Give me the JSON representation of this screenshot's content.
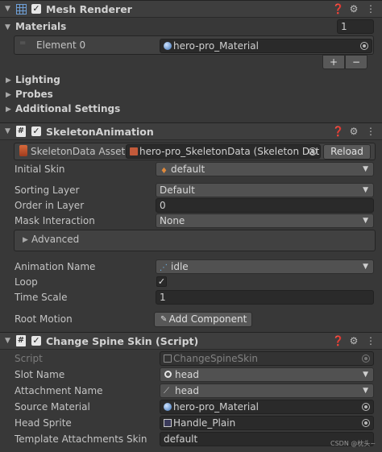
{
  "mesh_renderer": {
    "title": "Mesh Renderer",
    "materials_label": "Materials",
    "materials_count": "1",
    "element0_label": "Element 0",
    "element0_value": "hero-pro_Material",
    "plus": "+",
    "minus": "−",
    "lighting": "Lighting",
    "probes": "Probes",
    "additional_settings": "Additional Settings"
  },
  "skeleton_animation": {
    "title": "SkeletonAnimation",
    "skeleton_data_label": "SkeletonData Asset",
    "skeleton_data_value": "hero-pro_SkeletonData (Skeleton Dat",
    "reload": "Reload",
    "initial_skin_label": "Initial Skin",
    "initial_skin_value": "default",
    "sorting_layer_label": "Sorting Layer",
    "sorting_layer_value": "Default",
    "order_in_layer_label": "Order in Layer",
    "order_in_layer_value": "0",
    "mask_interaction_label": "Mask Interaction",
    "mask_interaction_value": "None",
    "advanced": "Advanced",
    "animation_name_label": "Animation Name",
    "animation_name_value": "idle",
    "loop_label": "Loop",
    "time_scale_label": "Time Scale",
    "time_scale_value": "1",
    "root_motion_label": "Root Motion",
    "add_component": "Add Component"
  },
  "change_spine_skin": {
    "title": "Change Spine Skin (Script)",
    "script_label": "Script",
    "script_value": "ChangeSpineSkin",
    "slot_name_label": "Slot Name",
    "slot_name_value": "head",
    "attachment_name_label": "Attachment Name",
    "attachment_name_value": "head",
    "source_material_label": "Source Material",
    "source_material_value": "hero-pro_Material",
    "head_sprite_label": "Head Sprite",
    "head_sprite_value": "Handle_Plain",
    "template_skin_label": "Template Attachments Skin",
    "template_skin_value": "default"
  },
  "watermark": "CSDN @枕头~",
  "colors": {
    "panel": "#383838",
    "header": "#3e3e3e",
    "field": "#2a2a2a",
    "dropdown": "#515151",
    "accent_blue": "#4a8fd6"
  }
}
